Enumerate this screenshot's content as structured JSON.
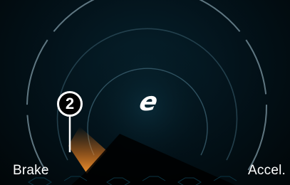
{
  "gauge": {
    "brake_label": "Brake",
    "accel_label": "Accel.",
    "mode_symbol": "e",
    "regen_level_fraction": 0.12,
    "regen_color": "#f08020",
    "ring_color": "#7f9aa6",
    "bezel_color": "#0b3140"
  },
  "callout": {
    "number": "2"
  }
}
